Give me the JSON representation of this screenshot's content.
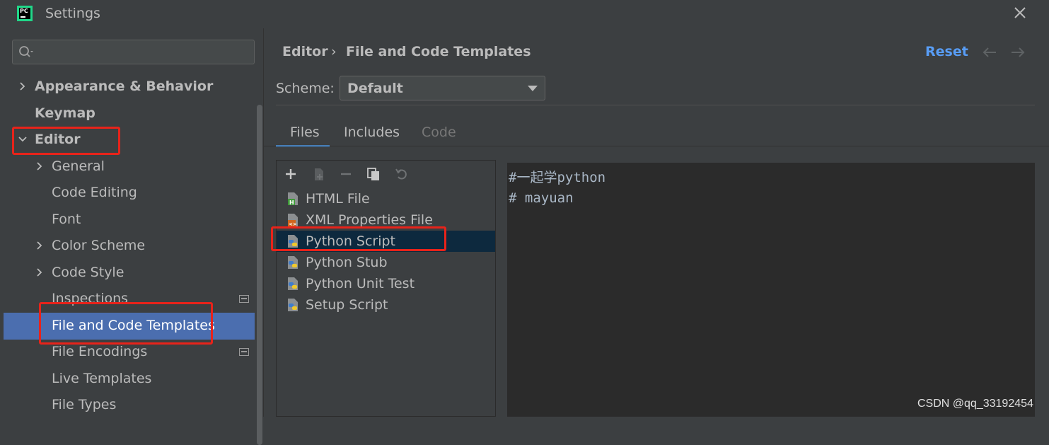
{
  "window": {
    "app_logo_text": "PC",
    "title": "Settings"
  },
  "sidebar": {
    "search_placeholder": "",
    "items": [
      {
        "label": "Appearance & Behavior"
      },
      {
        "label": "Keymap"
      },
      {
        "label": "Editor"
      },
      {
        "label": "General"
      },
      {
        "label": "Code Editing"
      },
      {
        "label": "Font"
      },
      {
        "label": "Color Scheme"
      },
      {
        "label": "Code Style"
      },
      {
        "label": "Inspections"
      },
      {
        "label": "File and Code Templates"
      },
      {
        "label": "File Encodings"
      },
      {
        "label": "Live Templates"
      },
      {
        "label": "File Types"
      }
    ]
  },
  "header": {
    "breadcrumb_parent": "Editor",
    "breadcrumb_separator": "›",
    "breadcrumb_current": "File and Code Templates",
    "reset_label": "Reset"
  },
  "scheme": {
    "label": "Scheme:",
    "value": "Default"
  },
  "tabs": [
    {
      "label": "Files"
    },
    {
      "label": "Includes"
    },
    {
      "label": "Code"
    }
  ],
  "templates": [
    {
      "label": "HTML File",
      "icon": "html-file-icon"
    },
    {
      "label": "XML Properties File",
      "icon": "xml-file-icon"
    },
    {
      "label": "Python Script",
      "icon": "python-file-icon"
    },
    {
      "label": "Python Stub",
      "icon": "python-file-icon"
    },
    {
      "label": "Python Unit Test",
      "icon": "python-file-icon"
    },
    {
      "label": "Setup Script",
      "icon": "python-file-icon"
    }
  ],
  "editor": {
    "lines": [
      "#一起学python",
      "# mayuan"
    ]
  },
  "watermark": "CSDN @qq_33192454",
  "colors": {
    "accent": "#4b6eaf",
    "link": "#589df6",
    "annotation": "#e8231a",
    "selected_row": "#0d293e"
  }
}
